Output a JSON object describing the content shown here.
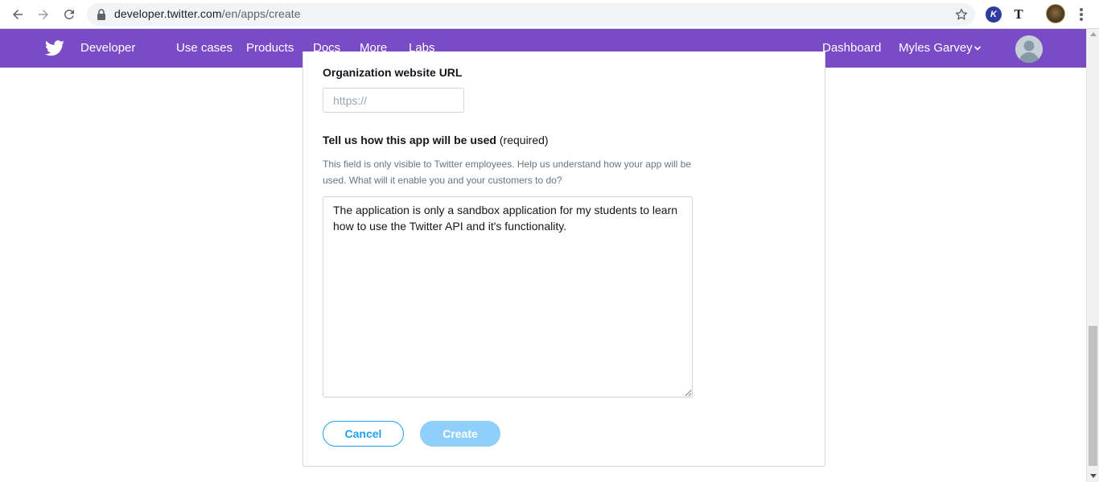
{
  "browser": {
    "url_host": "developer.twitter.com",
    "url_path": "/en/apps/create",
    "extensions": {
      "k_label": "K",
      "t_label": "T"
    }
  },
  "nav": {
    "brand": "Developer",
    "items": [
      "Use cases",
      "Products",
      "Docs",
      "More",
      "Labs"
    ],
    "dashboard": "Dashboard",
    "user": "Myles Garvey",
    "color": "#794bc4"
  },
  "form": {
    "website": {
      "label": "Organization website URL",
      "placeholder": "https://",
      "value": ""
    },
    "usage": {
      "label": "Tell us how this app will be used",
      "required": "(required)",
      "help": "This field is only visible to Twitter employees. Help us understand how your app will be used. What will it enable you and your customers to do?",
      "value": "The application is only a sandbox application for my students to learn how to use the Twitter API and it's functionality."
    },
    "cancel_label": "Cancel",
    "create_label": "Create"
  },
  "colors": {
    "accent": "#1da1f2",
    "create_disabled": "#8ed0f9"
  }
}
